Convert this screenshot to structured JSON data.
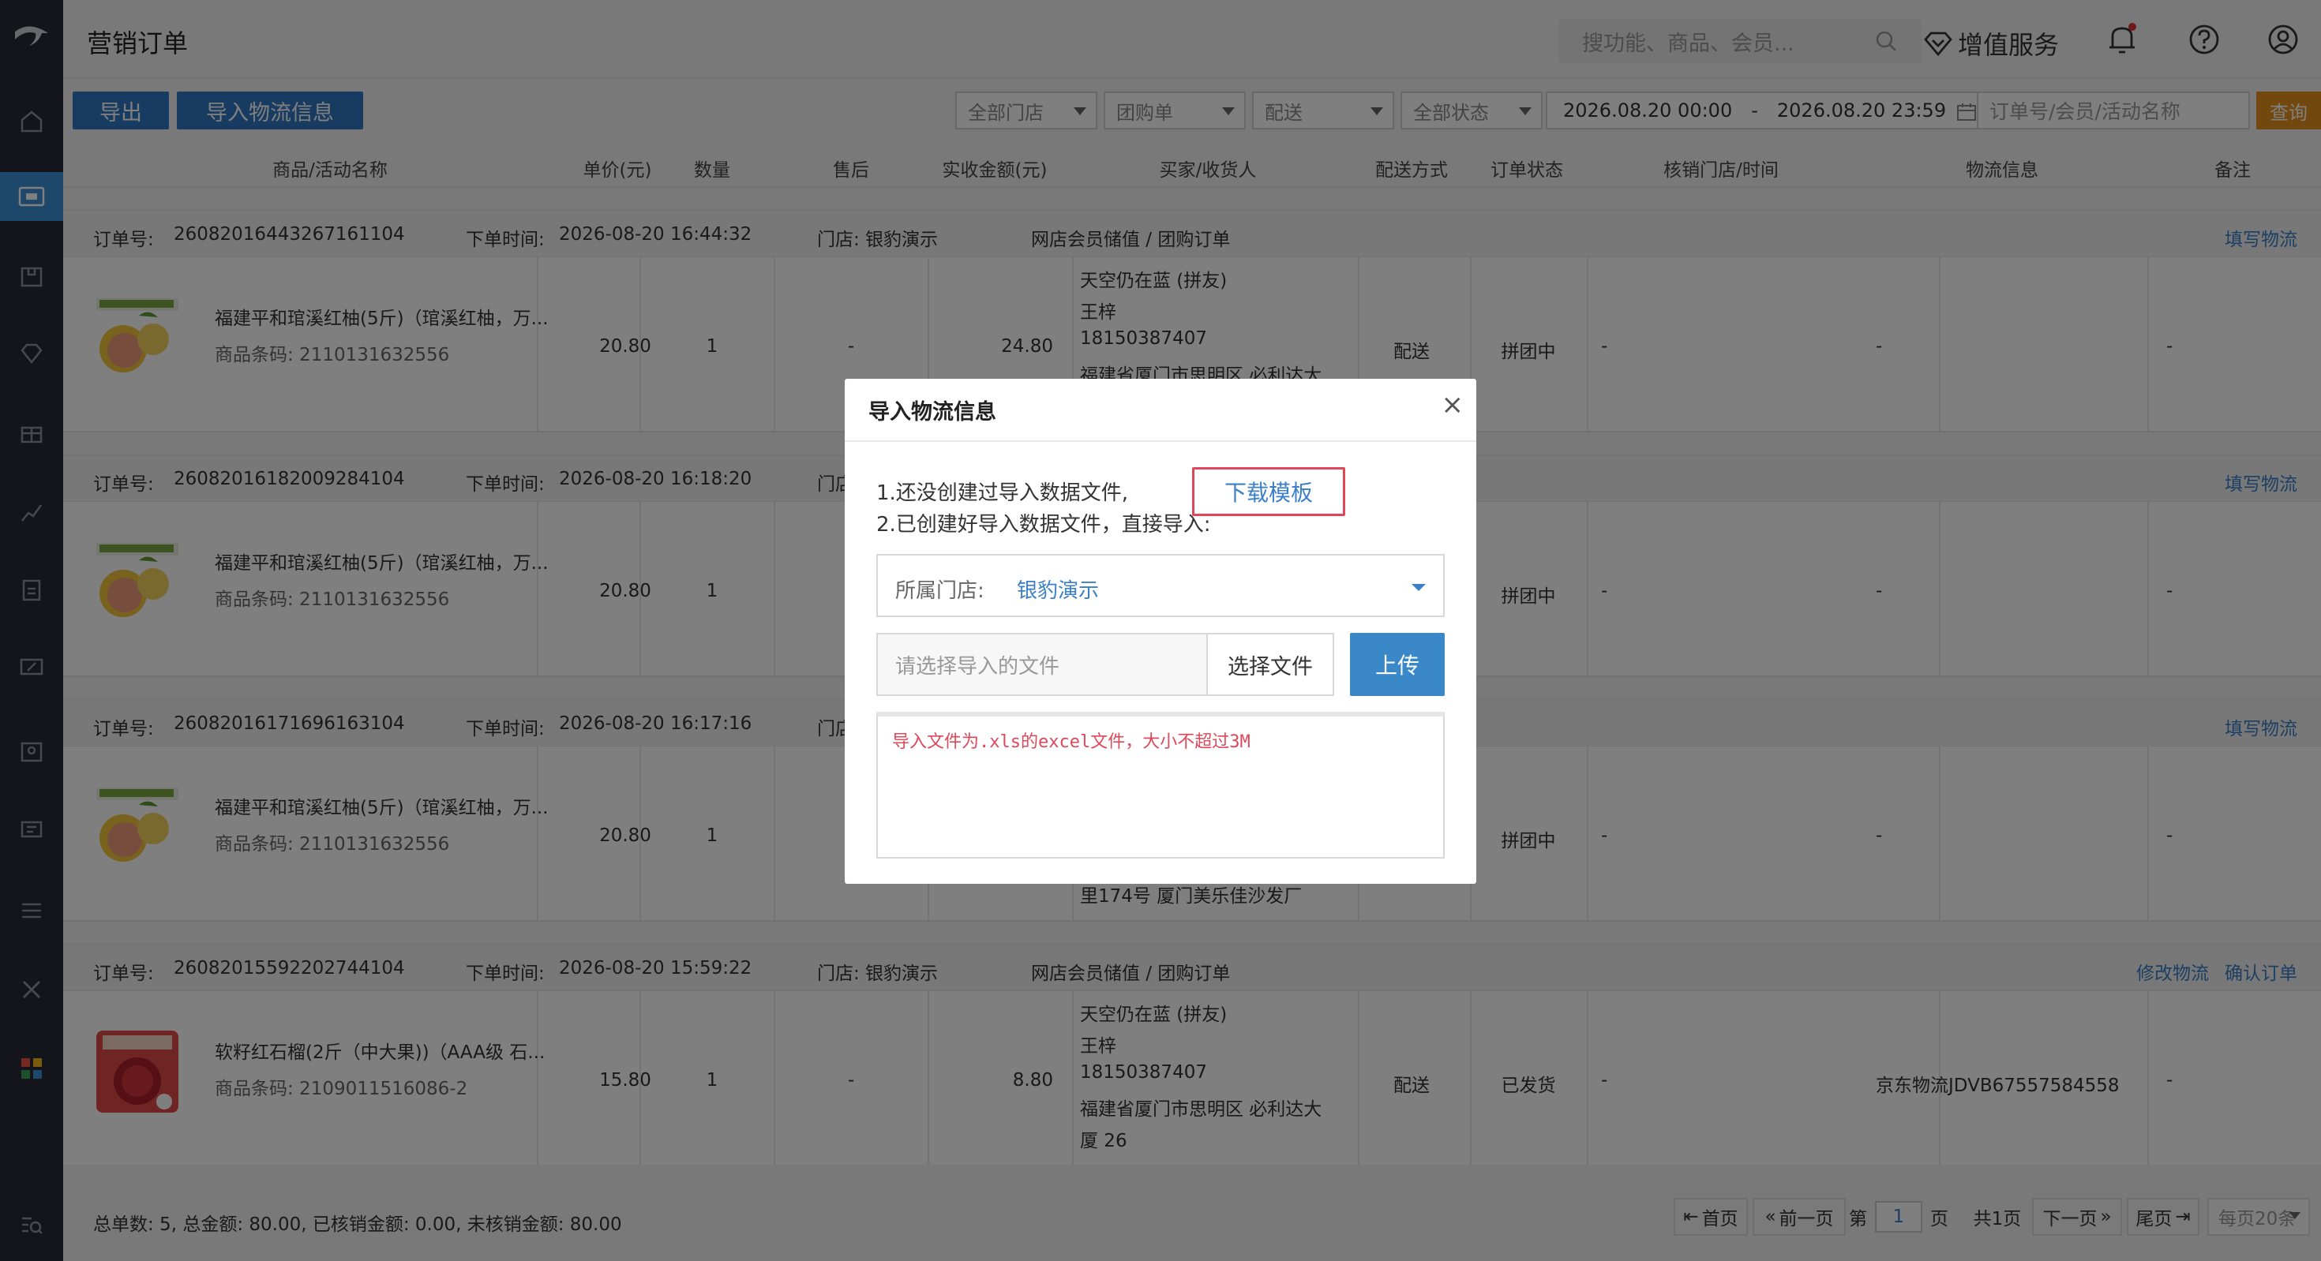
{
  "header": {
    "title": "营销订单",
    "search_placeholder": "搜功能、商品、会员...",
    "value_service": "增值服务"
  },
  "toolbar": {
    "export_label": "导出",
    "import_label": "导入物流信息",
    "store_filter": "全部门店",
    "type_filter": "团购单",
    "delivery_filter": "配送",
    "status_filter": "全部状态",
    "date_start": "2026.08.20 00:00",
    "date_sep": "-",
    "date_end": "2026.08.20 23:59",
    "order_placeholder": "订单号/会员/活动名称",
    "query_label": "查询"
  },
  "columns": [
    "商品/活动名称",
    "单价(元)",
    "数量",
    "售后",
    "实收金额(元)",
    "买家/收货人",
    "配送方式",
    "订单状态",
    "核销门店/时间",
    "物流信息",
    "备注"
  ],
  "orders": [
    {
      "order_no_label": "订单号:",
      "order_no": "26082016443267161104",
      "time_label": "下单时间:",
      "time": "2026-08-20 16:44:32",
      "store": "门店: 银豹演示",
      "type": "网店会员储值 / 团购订单",
      "actions": [
        "填写物流"
      ],
      "product": "福建平和琯溪红柚(5斤)（琯溪红柚，万...",
      "barcode": "商品条码: 2110131632556",
      "price": "20.80",
      "qty": "1",
      "after_sale": "-",
      "amount": "24.80",
      "buyer_lines": [
        "天空仍在蓝 (拼友)",
        "王梓",
        "18150387407",
        "福建省厦门市思明区 必利达大"
      ],
      "delivery": "配送",
      "status": "拼团中",
      "verify": "-",
      "logistics": "-",
      "remark": "-"
    },
    {
      "order_no_label": "订单号:",
      "order_no": "26082016182009284104",
      "time_label": "下单时间:",
      "time": "2026-08-20 16:18:20",
      "store": "门店",
      "type": "",
      "actions": [
        "填写物流"
      ],
      "product": "福建平和琯溪红柚(5斤)（琯溪红柚，万...",
      "barcode": "商品条码: 2110131632556",
      "price": "20.80",
      "qty": "1",
      "after_sale": "",
      "amount": "",
      "buyer_lines": [],
      "delivery": "",
      "status": "拼团中",
      "verify": "-",
      "logistics": "-",
      "remark": "-"
    },
    {
      "order_no_label": "订单号:",
      "order_no": "26082016171696163104",
      "time_label": "下单时间:",
      "time": "2026-08-20 16:17:16",
      "store": "门店",
      "type": "",
      "actions": [
        "填写物流"
      ],
      "product": "福建平和琯溪红柚(5斤)（琯溪红柚，万...",
      "barcode": "商品条码: 2110131632556",
      "price": "20.80",
      "qty": "1",
      "after_sale": "",
      "amount": "",
      "buyer_lines": [
        "里174号 厦门美乐佳沙发厂"
      ],
      "delivery": "",
      "status": "拼团中",
      "verify": "-",
      "logistics": "-",
      "remark": "-"
    },
    {
      "order_no_label": "订单号:",
      "order_no": "26082015592202744104",
      "time_label": "下单时间:",
      "time": "2026-08-20 15:59:22",
      "store": "门店: 银豹演示",
      "type": "网店会员储值 / 团购订单",
      "actions": [
        "修改物流",
        "确认订单"
      ],
      "product": "软籽红石榴(2斤（中大果))（AAA级 石...",
      "barcode": "商品条码: 2109011516086-2",
      "price": "15.80",
      "qty": "1",
      "after_sale": "-",
      "amount": "8.80",
      "buyer_lines": [
        "天空仍在蓝 (拼友)",
        "王梓",
        "18150387407",
        "福建省厦门市思明区 必利达大",
        "厦 26"
      ],
      "delivery": "配送",
      "status": "已发货",
      "verify": "-",
      "logistics": "京东物流JDVB67557584558",
      "remark": "-"
    }
  ],
  "footer": {
    "summary": "总单数: 5, 总金额: 80.00, 已核销金额: 0.00, 未核销金额: 80.00",
    "first": "首页",
    "prev": "前一页",
    "page_prefix": "第",
    "page_value": "1",
    "page_suffix": "页",
    "total_pages": "共1页",
    "next": "下一页",
    "last": "尾页",
    "per_page": "每页20条"
  },
  "modal": {
    "title": "导入物流信息",
    "close": "×",
    "step1": "1.还没创建过导入数据文件,",
    "download_template": "下载模板",
    "step2": "2.已创建好导入数据文件，直接导入:",
    "store_label": "所属门店:",
    "store_value": "银豹演示",
    "file_placeholder": "请选择导入的文件",
    "choose_file": "选择文件",
    "upload": "上传",
    "note": "导入文件为.xls的excel文件，大小不超过3M"
  }
}
